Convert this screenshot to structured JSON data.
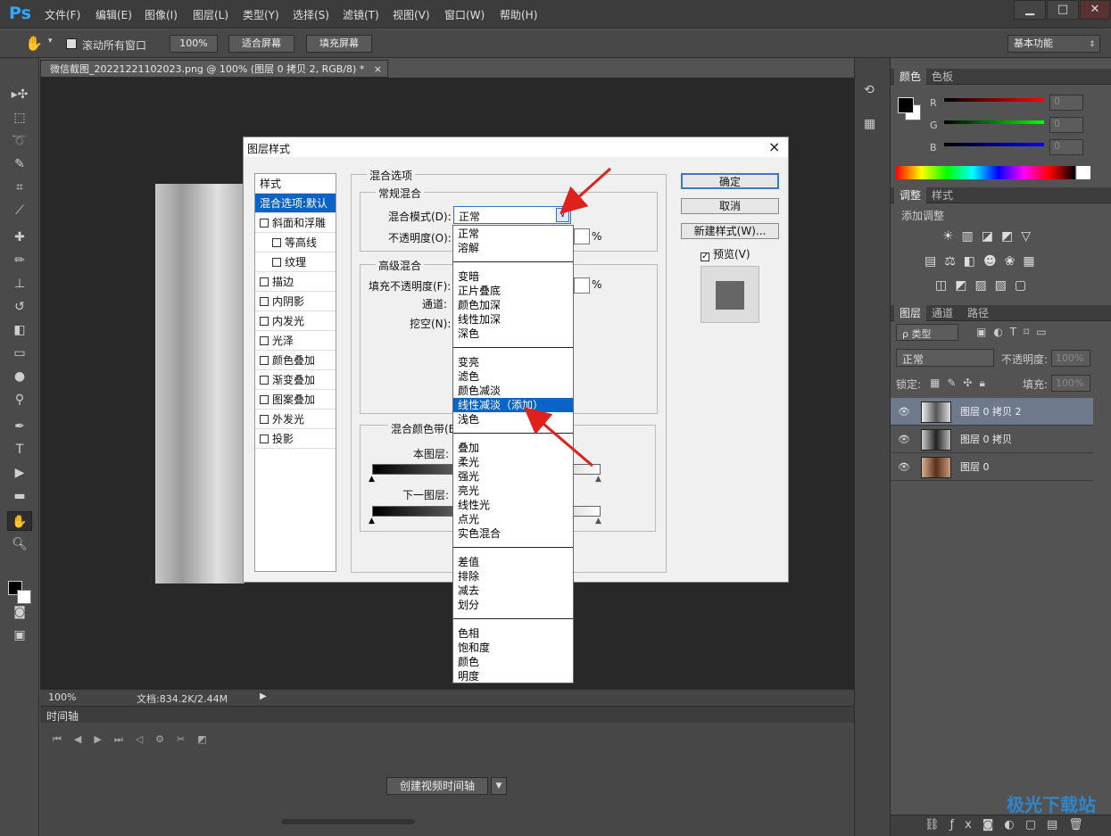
{
  "app": {
    "logo": "Ps"
  },
  "menu": [
    "文件(F)",
    "编辑(E)",
    "图像(I)",
    "图层(L)",
    "类型(Y)",
    "选择(S)",
    "滤镜(T)",
    "视图(V)",
    "窗口(W)",
    "帮助(H)"
  ],
  "options": {
    "scroll_all": "滚动所有窗口",
    "zoom": "100%",
    "fit_screen": "适合屏幕",
    "fill_screen": "填充屏幕",
    "workspace": "基本功能"
  },
  "document": {
    "tab_title": "微信截图_20221221102023.png @ 100% (图层 0 拷贝 2, RGB/8) *",
    "close": "×"
  },
  "status": {
    "zoom": "100%",
    "doc_info": "文档:834.2K/2.44M"
  },
  "timeline": {
    "title": "时间轴",
    "create_button": "创建视频时间轴"
  },
  "color_panel": {
    "tabs": [
      "颜色",
      "色板"
    ],
    "labels": [
      "R",
      "G",
      "B"
    ],
    "values": [
      "0",
      "0",
      "0"
    ]
  },
  "adjust_panel": {
    "tabs": [
      "调整",
      "样式"
    ],
    "hint": "添加调整"
  },
  "layers_panel": {
    "tabs": [
      "图层",
      "通道",
      "路径"
    ],
    "filter": "ρ 类型",
    "blend": "正常",
    "opacity_label": "不透明度:",
    "opacity_value": "100%",
    "lock_label": "锁定:",
    "fill_label": "填充:",
    "fill_value": "100%",
    "layers": [
      {
        "name": "图层 0 拷贝 2",
        "selected": true
      },
      {
        "name": "图层 0 拷贝",
        "selected": false
      },
      {
        "name": "图层 0",
        "selected": false
      }
    ]
  },
  "dialog": {
    "title": "图层样式",
    "close": "×",
    "style_list": [
      "样式",
      "混合选项:默认",
      "斜面和浮雕",
      "等高线",
      "纹理",
      "描边",
      "内阴影",
      "内发光",
      "光泽",
      "颜色叠加",
      "渐变叠加",
      "图案叠加",
      "外发光",
      "投影"
    ],
    "blend_options": "混合选项",
    "normal_blend": "常规混合",
    "blend_mode_label": "混合模式(D):",
    "blend_mode_value": "正常",
    "opacity_label": "不透明度(O):",
    "percent": "%",
    "advanced_blend": "高级混合",
    "fill_opacity_label": "填充不透明度(F):",
    "channels_label": "通道:",
    "knockout_label": "挖空(N):",
    "blend_if_label": "混合颜色带(E",
    "this_layer": "本图层:",
    "underlying_layer": "下一图层:",
    "ok": "确定",
    "cancel": "取消",
    "new_style": "新建样式(W)...",
    "preview": "预览(V)"
  },
  "dropdown": {
    "groups": [
      [
        "正常",
        "溶解"
      ],
      [
        "变暗",
        "正片叠底",
        "颜色加深",
        "线性加深",
        "深色"
      ],
      [
        "变亮",
        "滤色",
        "颜色减淡",
        "线性减淡（添加）",
        "浅色"
      ],
      [
        "叠加",
        "柔光",
        "强光",
        "亮光",
        "线性光",
        "点光",
        "实色混合"
      ],
      [
        "差值",
        "排除",
        "减去",
        "划分"
      ],
      [
        "色相",
        "饱和度",
        "颜色",
        "明度"
      ]
    ],
    "highlighted": "线性减淡（添加）"
  },
  "watermark": "极光下载站",
  "colors": {
    "accent": "#3399ff",
    "highlight": "#0a64c8",
    "arrow": "#e0201a"
  }
}
